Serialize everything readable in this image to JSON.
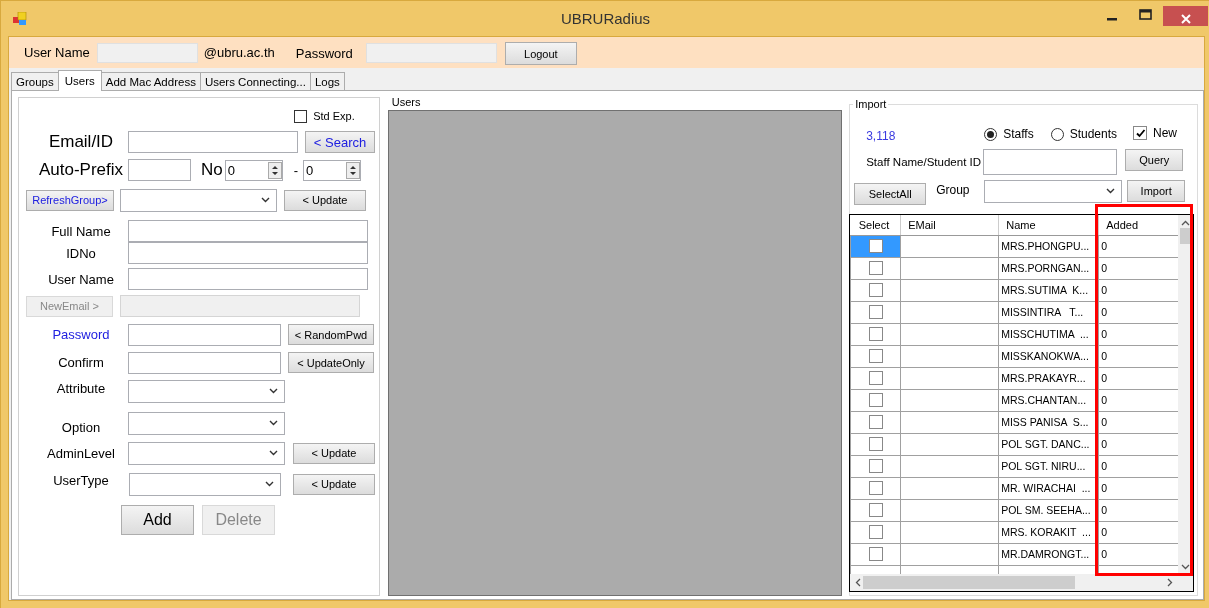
{
  "window": {
    "title": "UBRURadius"
  },
  "login": {
    "user_label": "User Name",
    "domain": "@ubru.ac.th",
    "password_label": "Password",
    "logout": "Logout"
  },
  "tabs": [
    {
      "label": "Groups",
      "selected": false
    },
    {
      "label": "Users",
      "selected": true
    },
    {
      "label": "Add Mac Address",
      "selected": false
    },
    {
      "label": "Users Connecting...",
      "selected": false
    },
    {
      "label": "Logs",
      "selected": false
    }
  ],
  "user_form": {
    "std_exp": {
      "label": "Std Exp.",
      "checked": false
    },
    "email": {
      "label": "Email/ID",
      "button": "< Search"
    },
    "auto_prefix": {
      "label": "Auto-Prefix",
      "no_label": "No",
      "from": "0",
      "dash": "-",
      "to": "0"
    },
    "group": {
      "button": "RefreshGroup>",
      "update": "< Update"
    },
    "full_name": {
      "label": "Full Name"
    },
    "idno": {
      "label": "IDNo"
    },
    "user_name": {
      "label": "User Name"
    },
    "new_email": {
      "button": "NewEmail >",
      "disabled": true
    },
    "password": {
      "label": "Password",
      "button": "< RandomPwd"
    },
    "confirm": {
      "label": "Confirm",
      "button": "< UpdateOnly"
    },
    "attribute": {
      "label": "Attribute"
    },
    "option": {
      "label": "Option"
    },
    "admin_level": {
      "label": "AdminLevel",
      "button": "< Update"
    },
    "user_type": {
      "label": "UserType",
      "button": "< Update"
    },
    "add": {
      "label": "Add",
      "disabled": false
    },
    "delete": {
      "label": "Delete",
      "disabled": true
    }
  },
  "users_panel": {
    "title": "Users"
  },
  "import": {
    "title": "Import",
    "count": "3,118",
    "radios": [
      {
        "label": "Staffs",
        "selected": true
      },
      {
        "label": "Students",
        "selected": false
      }
    ],
    "new": {
      "label": "New",
      "checked": true
    },
    "search_label": "Staff Name/Student ID",
    "query": "Query",
    "select_all": "SelectAll",
    "group_label": "Group",
    "import_button": "Import",
    "columns": [
      {
        "label": "Select",
        "highlighted": false
      },
      {
        "label": "EMail",
        "highlighted": false
      },
      {
        "label": "Name",
        "highlighted": false
      },
      {
        "label": "Added",
        "highlighted": true
      }
    ],
    "rows": [
      {
        "selected": true,
        "checked": false,
        "name": "MRS.PHONGPU...",
        "added": "0"
      },
      {
        "selected": false,
        "checked": false,
        "name": "MRS.PORNGAN...",
        "added": "0"
      },
      {
        "selected": false,
        "checked": false,
        "name": "MRS.SUTIMA  K...",
        "added": "0"
      },
      {
        "selected": false,
        "checked": false,
        "name": "MISSINTIRA   T...",
        "added": "0"
      },
      {
        "selected": false,
        "checked": false,
        "name": "MISSCHUTIMA  ...",
        "added": "0"
      },
      {
        "selected": false,
        "checked": false,
        "name": "MISSKANOKWA...",
        "added": "0"
      },
      {
        "selected": false,
        "checked": false,
        "name": "MRS.PRAKAYR...",
        "added": "0"
      },
      {
        "selected": false,
        "checked": false,
        "name": "MRS.CHANTAN...",
        "added": "0"
      },
      {
        "selected": false,
        "checked": false,
        "name": "MISS PANISA  S...",
        "added": "0"
      },
      {
        "selected": false,
        "checked": false,
        "name": "POL SGT. DANC...",
        "added": "0"
      },
      {
        "selected": false,
        "checked": false,
        "name": "POL SGT. NIRU...",
        "added": "0"
      },
      {
        "selected": false,
        "checked": false,
        "name": "MR. WIRACHAI  ...",
        "added": "0"
      },
      {
        "selected": false,
        "checked": false,
        "name": "POL SM. SEEHA...",
        "added": "0"
      },
      {
        "selected": false,
        "checked": false,
        "name": "MRS. KORAKIT  ...",
        "added": "0"
      },
      {
        "selected": false,
        "checked": false,
        "name": "MR.DAMRONGT...",
        "added": "0"
      }
    ]
  }
}
